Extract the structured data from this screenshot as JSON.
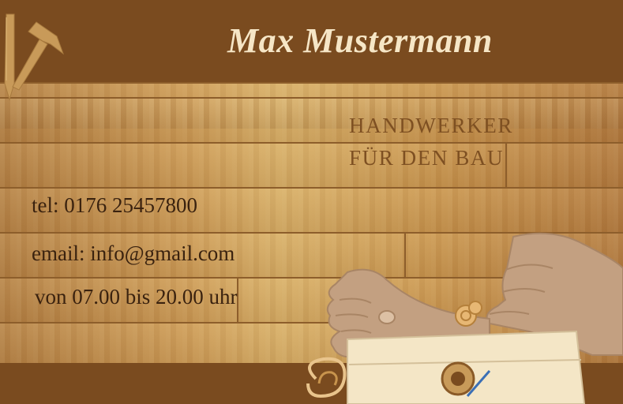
{
  "card": {
    "name": "Max Mustermann",
    "job_line1": "HANDWERKER",
    "job_line2": "FÜR DEN BAU",
    "phone": "tel: 0176 25457800",
    "email": "email: info@gmail.com",
    "hours": "von 07.00 bis 20.00 uhr"
  },
  "icons": {
    "logo": "hammer-and-saw-icon",
    "illustration": "hands-with-wood-plane-illustration"
  },
  "colors": {
    "bar_brown": "#7a4b1f",
    "name_text": "#f6e6c6",
    "job_text": "#7e5022",
    "info_text": "#3a220f",
    "wood": "#cc9a55"
  }
}
